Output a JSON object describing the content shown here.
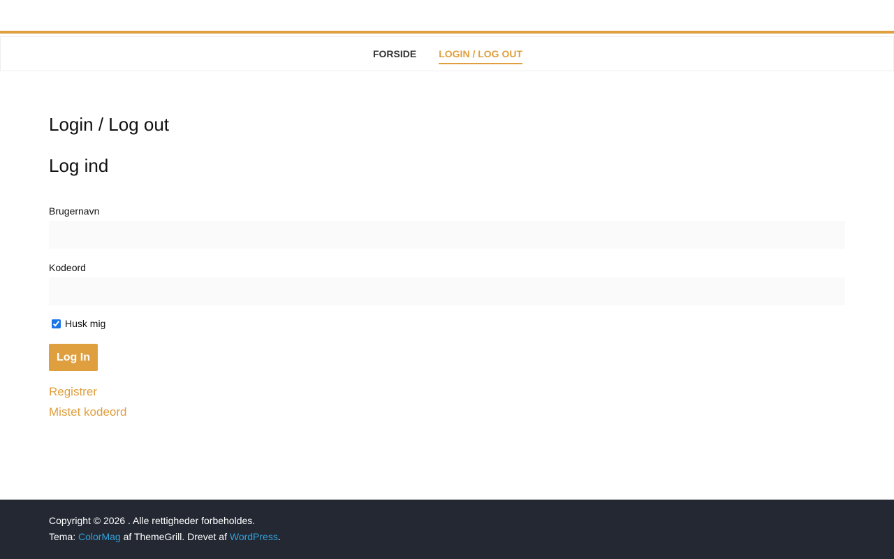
{
  "nav": {
    "items": [
      {
        "label": "Forside",
        "active": false
      },
      {
        "label": "Login / Log out",
        "active": true
      }
    ]
  },
  "main": {
    "page_title": "Login / Log out",
    "form_title": "Log ind",
    "username_label": "Brugernavn",
    "username_value": "",
    "password_label": "Kodeord",
    "password_value": "",
    "remember_label": "Husk mig",
    "remember_checked": true,
    "login_button": "Log In",
    "register_link": "Registrer",
    "lost_password_link": "Mistet kodeord"
  },
  "footer": {
    "copyright": "Copyright © 2026 . Alle rettigheder forbeholdes.",
    "theme_prefix": "Tema: ",
    "theme_link": "ColorMag",
    "theme_middle": " af ThemeGrill. Drevet af ",
    "wp_link": "WordPress",
    "theme_suffix": "."
  },
  "colors": {
    "accent": "#e09f3e",
    "footer_bg": "#232833",
    "footer_link": "#33a1d6"
  }
}
